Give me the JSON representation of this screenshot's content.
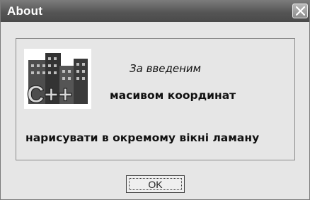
{
  "window": {
    "title": "About",
    "close_icon": "close-icon"
  },
  "about": {
    "logo_icon": "cpp-buildings-logo",
    "logo_text": "C++",
    "line1": "За введеним",
    "line2": "масивом координат",
    "line3": "нарисувати в окремому вікні ламану"
  },
  "buttons": {
    "ok_label": "OK"
  },
  "colors": {
    "titlebar": "#555555",
    "background": "#e6e6e6"
  }
}
